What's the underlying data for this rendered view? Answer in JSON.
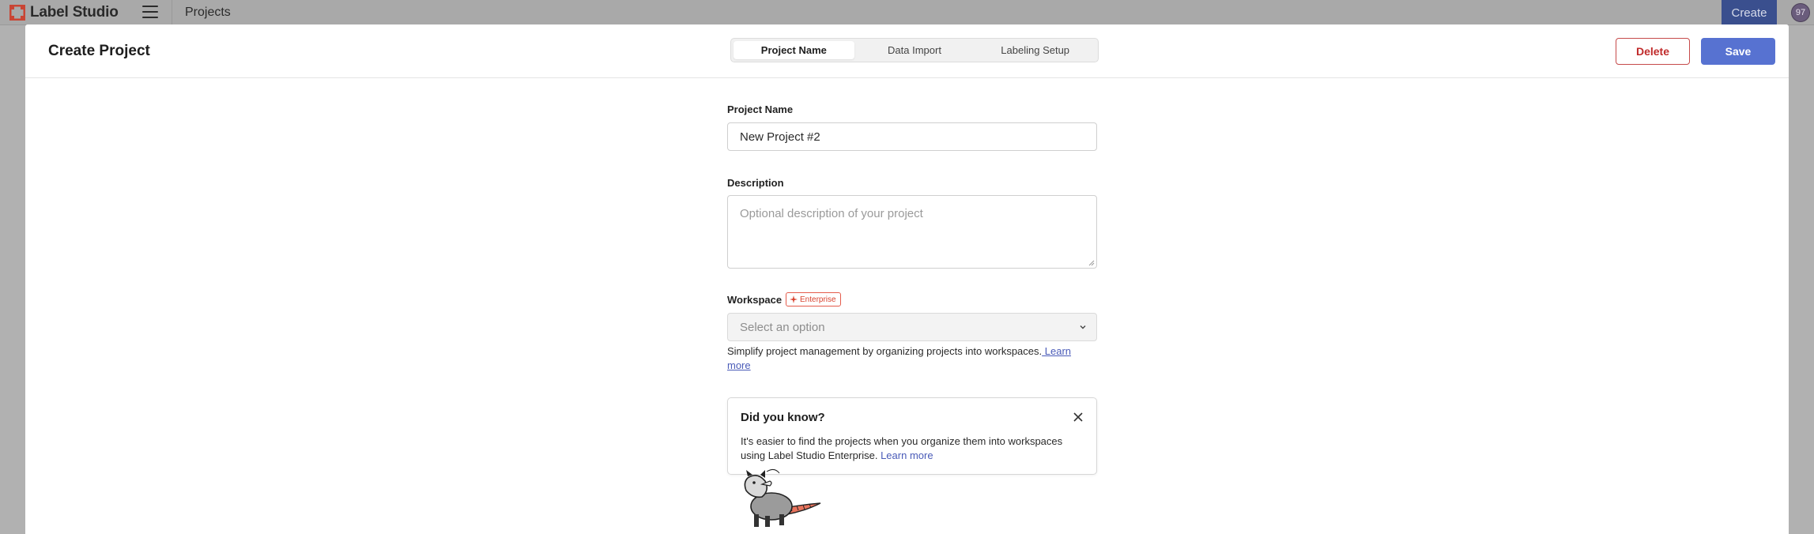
{
  "app": {
    "name": "Label Studio",
    "nav_title": "Projects",
    "create_label": "Create",
    "avatar_initials": "97",
    "brand_color": "#e0513f"
  },
  "modal": {
    "title": "Create Project",
    "steps": [
      {
        "label": "Project Name",
        "active": true
      },
      {
        "label": "Data Import",
        "active": false
      },
      {
        "label": "Labeling Setup",
        "active": false
      }
    ],
    "delete_label": "Delete",
    "save_label": "Save"
  },
  "form": {
    "project_name_label": "Project Name",
    "project_name_value": "New Project #2",
    "description_label": "Description",
    "description_placeholder": "Optional description of your project",
    "workspace_label": "Workspace",
    "enterprise_badge": "Enterprise",
    "workspace_placeholder": "Select an option",
    "helper_text": "Simplify project management by organizing projects into workspaces.",
    "helper_link": " Learn more"
  },
  "tip": {
    "title": "Did you know?",
    "text": "It's easier to find the projects when you organize them into workspaces using Label Studio Enterprise.",
    "link": "Learn more"
  },
  "colors": {
    "primary": "#5772d1",
    "danger": "#c02b2b",
    "enterprise": "#d9432f"
  }
}
